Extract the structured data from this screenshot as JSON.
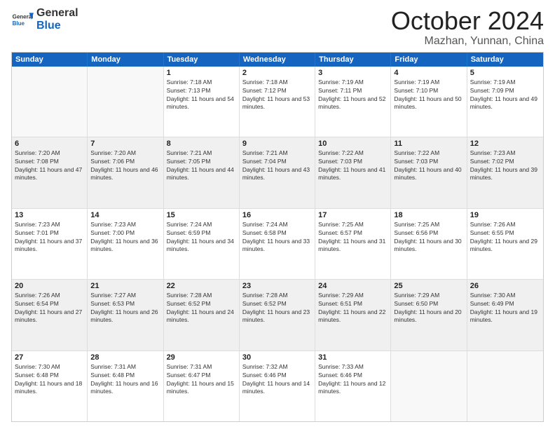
{
  "header": {
    "logo_general": "General",
    "logo_blue": "Blue",
    "month_title": "October 2024",
    "location": "Mazhan, Yunnan, China"
  },
  "days_of_week": [
    "Sunday",
    "Monday",
    "Tuesday",
    "Wednesday",
    "Thursday",
    "Friday",
    "Saturday"
  ],
  "weeks": [
    [
      {
        "day": "",
        "sunrise": "",
        "sunset": "",
        "daylight": "",
        "empty": true
      },
      {
        "day": "",
        "sunrise": "",
        "sunset": "",
        "daylight": "",
        "empty": true
      },
      {
        "day": "1",
        "sunrise": "Sunrise: 7:18 AM",
        "sunset": "Sunset: 7:13 PM",
        "daylight": "Daylight: 11 hours and 54 minutes.",
        "empty": false
      },
      {
        "day": "2",
        "sunrise": "Sunrise: 7:18 AM",
        "sunset": "Sunset: 7:12 PM",
        "daylight": "Daylight: 11 hours and 53 minutes.",
        "empty": false
      },
      {
        "day": "3",
        "sunrise": "Sunrise: 7:19 AM",
        "sunset": "Sunset: 7:11 PM",
        "daylight": "Daylight: 11 hours and 52 minutes.",
        "empty": false
      },
      {
        "day": "4",
        "sunrise": "Sunrise: 7:19 AM",
        "sunset": "Sunset: 7:10 PM",
        "daylight": "Daylight: 11 hours and 50 minutes.",
        "empty": false
      },
      {
        "day": "5",
        "sunrise": "Sunrise: 7:19 AM",
        "sunset": "Sunset: 7:09 PM",
        "daylight": "Daylight: 11 hours and 49 minutes.",
        "empty": false
      }
    ],
    [
      {
        "day": "6",
        "sunrise": "Sunrise: 7:20 AM",
        "sunset": "Sunset: 7:08 PM",
        "daylight": "Daylight: 11 hours and 47 minutes.",
        "empty": false
      },
      {
        "day": "7",
        "sunrise": "Sunrise: 7:20 AM",
        "sunset": "Sunset: 7:06 PM",
        "daylight": "Daylight: 11 hours and 46 minutes.",
        "empty": false
      },
      {
        "day": "8",
        "sunrise": "Sunrise: 7:21 AM",
        "sunset": "Sunset: 7:05 PM",
        "daylight": "Daylight: 11 hours and 44 minutes.",
        "empty": false
      },
      {
        "day": "9",
        "sunrise": "Sunrise: 7:21 AM",
        "sunset": "Sunset: 7:04 PM",
        "daylight": "Daylight: 11 hours and 43 minutes.",
        "empty": false
      },
      {
        "day": "10",
        "sunrise": "Sunrise: 7:22 AM",
        "sunset": "Sunset: 7:03 PM",
        "daylight": "Daylight: 11 hours and 41 minutes.",
        "empty": false
      },
      {
        "day": "11",
        "sunrise": "Sunrise: 7:22 AM",
        "sunset": "Sunset: 7:03 PM",
        "daylight": "Daylight: 11 hours and 40 minutes.",
        "empty": false
      },
      {
        "day": "12",
        "sunrise": "Sunrise: 7:23 AM",
        "sunset": "Sunset: 7:02 PM",
        "daylight": "Daylight: 11 hours and 39 minutes.",
        "empty": false
      }
    ],
    [
      {
        "day": "13",
        "sunrise": "Sunrise: 7:23 AM",
        "sunset": "Sunset: 7:01 PM",
        "daylight": "Daylight: 11 hours and 37 minutes.",
        "empty": false
      },
      {
        "day": "14",
        "sunrise": "Sunrise: 7:23 AM",
        "sunset": "Sunset: 7:00 PM",
        "daylight": "Daylight: 11 hours and 36 minutes.",
        "empty": false
      },
      {
        "day": "15",
        "sunrise": "Sunrise: 7:24 AM",
        "sunset": "Sunset: 6:59 PM",
        "daylight": "Daylight: 11 hours and 34 minutes.",
        "empty": false
      },
      {
        "day": "16",
        "sunrise": "Sunrise: 7:24 AM",
        "sunset": "Sunset: 6:58 PM",
        "daylight": "Daylight: 11 hours and 33 minutes.",
        "empty": false
      },
      {
        "day": "17",
        "sunrise": "Sunrise: 7:25 AM",
        "sunset": "Sunset: 6:57 PM",
        "daylight": "Daylight: 11 hours and 31 minutes.",
        "empty": false
      },
      {
        "day": "18",
        "sunrise": "Sunrise: 7:25 AM",
        "sunset": "Sunset: 6:56 PM",
        "daylight": "Daylight: 11 hours and 30 minutes.",
        "empty": false
      },
      {
        "day": "19",
        "sunrise": "Sunrise: 7:26 AM",
        "sunset": "Sunset: 6:55 PM",
        "daylight": "Daylight: 11 hours and 29 minutes.",
        "empty": false
      }
    ],
    [
      {
        "day": "20",
        "sunrise": "Sunrise: 7:26 AM",
        "sunset": "Sunset: 6:54 PM",
        "daylight": "Daylight: 11 hours and 27 minutes.",
        "empty": false
      },
      {
        "day": "21",
        "sunrise": "Sunrise: 7:27 AM",
        "sunset": "Sunset: 6:53 PM",
        "daylight": "Daylight: 11 hours and 26 minutes.",
        "empty": false
      },
      {
        "day": "22",
        "sunrise": "Sunrise: 7:28 AM",
        "sunset": "Sunset: 6:52 PM",
        "daylight": "Daylight: 11 hours and 24 minutes.",
        "empty": false
      },
      {
        "day": "23",
        "sunrise": "Sunrise: 7:28 AM",
        "sunset": "Sunset: 6:52 PM",
        "daylight": "Daylight: 11 hours and 23 minutes.",
        "empty": false
      },
      {
        "day": "24",
        "sunrise": "Sunrise: 7:29 AM",
        "sunset": "Sunset: 6:51 PM",
        "daylight": "Daylight: 11 hours and 22 minutes.",
        "empty": false
      },
      {
        "day": "25",
        "sunrise": "Sunrise: 7:29 AM",
        "sunset": "Sunset: 6:50 PM",
        "daylight": "Daylight: 11 hours and 20 minutes.",
        "empty": false
      },
      {
        "day": "26",
        "sunrise": "Sunrise: 7:30 AM",
        "sunset": "Sunset: 6:49 PM",
        "daylight": "Daylight: 11 hours and 19 minutes.",
        "empty": false
      }
    ],
    [
      {
        "day": "27",
        "sunrise": "Sunrise: 7:30 AM",
        "sunset": "Sunset: 6:48 PM",
        "daylight": "Daylight: 11 hours and 18 minutes.",
        "empty": false
      },
      {
        "day": "28",
        "sunrise": "Sunrise: 7:31 AM",
        "sunset": "Sunset: 6:48 PM",
        "daylight": "Daylight: 11 hours and 16 minutes.",
        "empty": false
      },
      {
        "day": "29",
        "sunrise": "Sunrise: 7:31 AM",
        "sunset": "Sunset: 6:47 PM",
        "daylight": "Daylight: 11 hours and 15 minutes.",
        "empty": false
      },
      {
        "day": "30",
        "sunrise": "Sunrise: 7:32 AM",
        "sunset": "Sunset: 6:46 PM",
        "daylight": "Daylight: 11 hours and 14 minutes.",
        "empty": false
      },
      {
        "day": "31",
        "sunrise": "Sunrise: 7:33 AM",
        "sunset": "Sunset: 6:46 PM",
        "daylight": "Daylight: 11 hours and 12 minutes.",
        "empty": false
      },
      {
        "day": "",
        "sunrise": "",
        "sunset": "",
        "daylight": "",
        "empty": true
      },
      {
        "day": "",
        "sunrise": "",
        "sunset": "",
        "daylight": "",
        "empty": true
      }
    ]
  ]
}
